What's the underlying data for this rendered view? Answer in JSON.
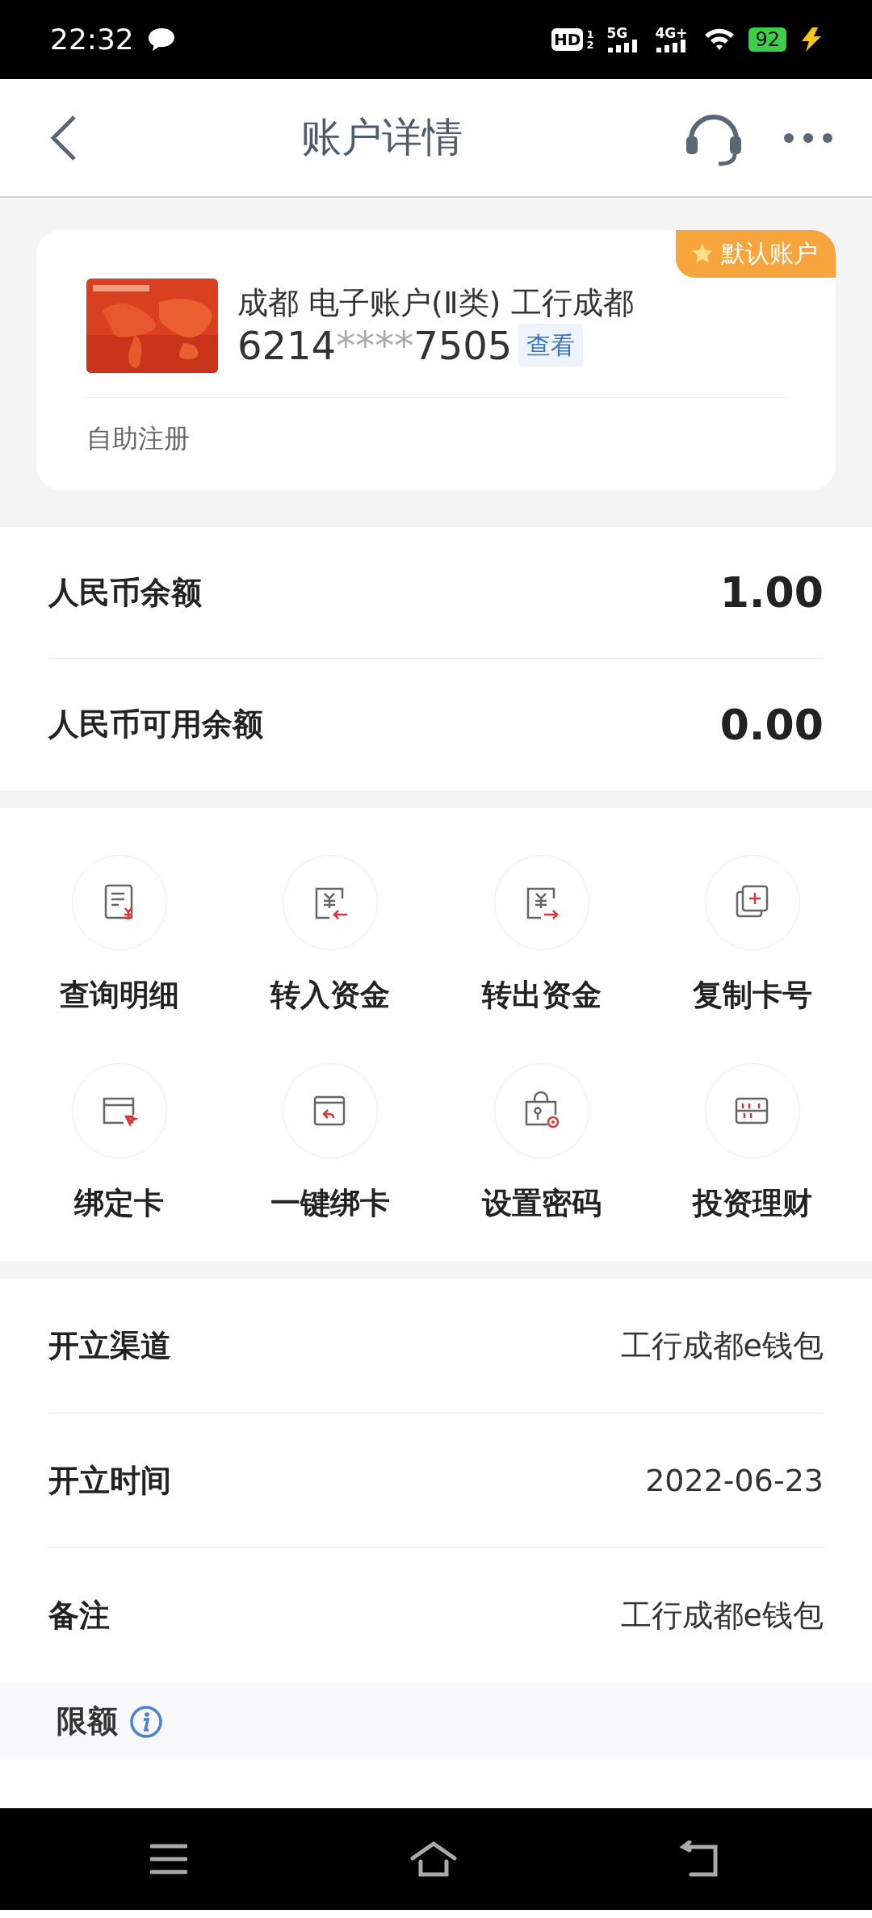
{
  "status_bar": {
    "time": "22:32",
    "hd": {
      "label": "HD",
      "sims": [
        "1",
        "2"
      ]
    },
    "networks": [
      {
        "label": "5G"
      },
      {
        "label": "4G+"
      }
    ],
    "battery": {
      "label": "92",
      "charging": true
    }
  },
  "header": {
    "title": "账户详情"
  },
  "account": {
    "badge": "默认账户",
    "name": "成都 电子账户(Ⅱ类) 工行成都",
    "number_head": "6214",
    "number_mask": "****",
    "number_tail": "7505",
    "reveal": "查看",
    "source": "自助注册"
  },
  "balances": [
    {
      "label": "人民币余额",
      "value": "1.00"
    },
    {
      "label": "人民币可用余额",
      "value": "0.00"
    }
  ],
  "actions": [
    {
      "label": "查询明细",
      "kind": "statement"
    },
    {
      "label": "转入资金",
      "kind": "transfer_in"
    },
    {
      "label": "转出资金",
      "kind": "transfer_out"
    },
    {
      "label": "复制卡号",
      "kind": "copy"
    },
    {
      "label": "绑定卡",
      "kind": "bind"
    },
    {
      "label": "一键绑卡",
      "kind": "quick_bind"
    },
    {
      "label": "设置密码",
      "kind": "password"
    },
    {
      "label": "投资理财",
      "kind": "invest"
    }
  ],
  "details": [
    {
      "label": "开立渠道",
      "value": "工行成都e钱包"
    },
    {
      "label": "开立时间",
      "value": "2022-06-23"
    },
    {
      "label": "备注",
      "value": "工行成都e钱包"
    }
  ],
  "limit": {
    "title": "限额"
  }
}
